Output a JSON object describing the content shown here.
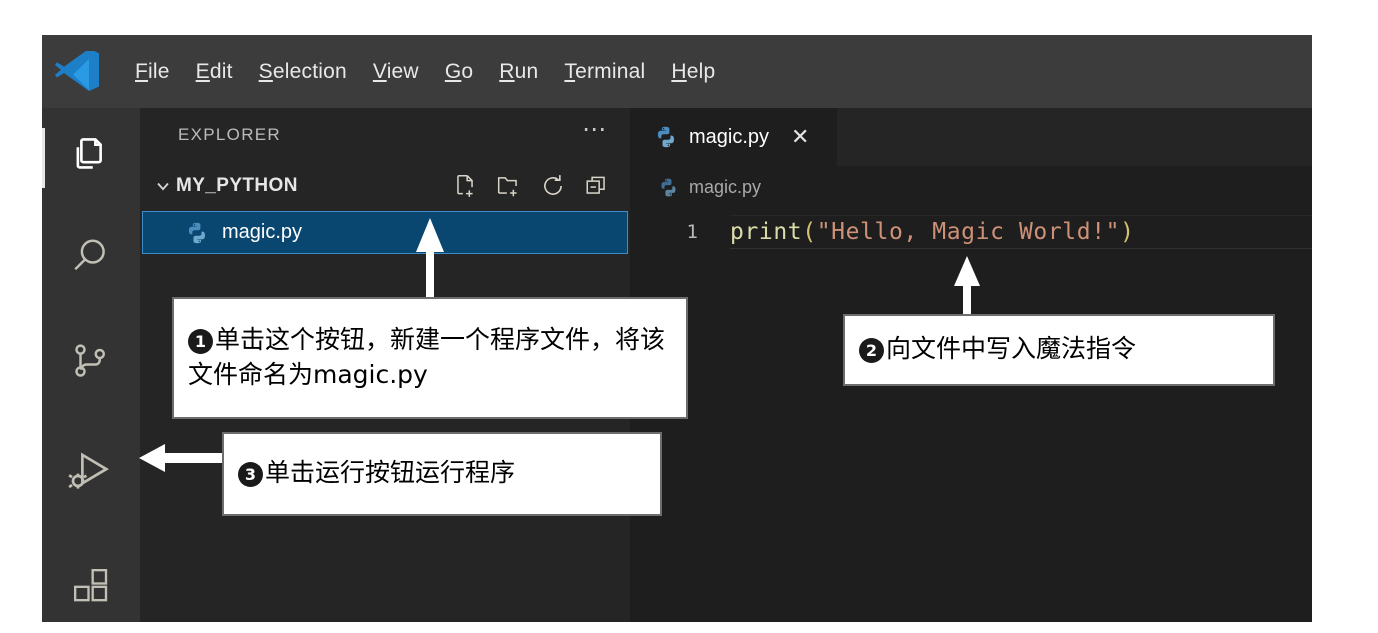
{
  "app": {
    "name": "Visual Studio Code",
    "logo_icon": "vscode-logo-icon"
  },
  "menubar": {
    "items": [
      {
        "mnemonic": "F",
        "rest": "ile",
        "label": "File"
      },
      {
        "mnemonic": "E",
        "rest": "dit",
        "label": "Edit"
      },
      {
        "mnemonic": "S",
        "rest": "election",
        "label": "Selection"
      },
      {
        "mnemonic": "V",
        "rest": "iew",
        "label": "View"
      },
      {
        "mnemonic": "G",
        "rest": "o",
        "label": "Go"
      },
      {
        "mnemonic": "R",
        "rest": "un",
        "label": "Run"
      },
      {
        "mnemonic": "T",
        "rest": "erminal",
        "label": "Terminal"
      },
      {
        "mnemonic": "H",
        "rest": "elp",
        "label": "Help"
      }
    ]
  },
  "activitybar": {
    "items": [
      {
        "icon": "files-explorer-icon",
        "label": "Explorer",
        "active": true
      },
      {
        "icon": "search-icon",
        "label": "Search",
        "active": false
      },
      {
        "icon": "source-control-branch-icon",
        "label": "Source Control",
        "active": false
      },
      {
        "icon": "run-and-debug-icon",
        "label": "Run and Debug",
        "active": false
      },
      {
        "icon": "extensions-blocks-icon",
        "label": "Extensions",
        "active": false
      }
    ]
  },
  "sidebar": {
    "title": "EXPLORER",
    "more_actions_icon": "ellipsis-icon",
    "folder": {
      "name": "MY_PYTHON",
      "chevron_icon": "chevron-down-icon",
      "expanded": true,
      "actions": [
        {
          "icon": "new-file-icon",
          "label": "New File"
        },
        {
          "icon": "new-folder-icon",
          "label": "New Folder"
        },
        {
          "icon": "refresh-icon",
          "label": "Refresh Explorer"
        },
        {
          "icon": "collapse-all-icon",
          "label": "Collapse Folders in Explorer"
        }
      ]
    },
    "files": [
      {
        "name": "magic.py",
        "icon": "python-file-icon",
        "selected": true
      }
    ]
  },
  "editor": {
    "tab": {
      "name": "magic.py",
      "icon": "python-file-icon",
      "close_icon": "close-icon",
      "active": true
    },
    "breadcrumb": {
      "icon": "python-file-icon",
      "text": "magic.py"
    },
    "code": {
      "line_number": "1",
      "tokens": [
        {
          "text": "print",
          "type": "function"
        },
        {
          "text": "(",
          "type": "paren"
        },
        {
          "text": "\"Hello, Magic World!\"",
          "type": "string"
        },
        {
          "text": ")",
          "type": "paren"
        }
      ],
      "full_line": "print(\"Hello, Magic World!\")"
    }
  },
  "callouts": [
    {
      "number": "1",
      "number_glyph": "❶",
      "text": "单击这个按钮，新建一个程序文件，将该文件命名为magic.py",
      "arrow": "arrow-up",
      "points_to": "new-file-icon"
    },
    {
      "number": "2",
      "number_glyph": "❷",
      "text": "向文件中写入魔法指令",
      "arrow": "arrow-up",
      "points_to": "code-line"
    },
    {
      "number": "3",
      "number_glyph": "❸",
      "text": "单击运行按钮运行程序",
      "arrow": "arrow-left",
      "points_to": "run-and-debug-icon"
    }
  ],
  "colors": {
    "menubar_bg": "#3c3c3c",
    "activitybar_bg": "#333333",
    "sidebar_bg": "#252526",
    "editor_bg": "#1e1e1e",
    "selection_blue": "#094771",
    "selection_border": "#3f8cc9",
    "accent_python_blue": "#4b8bbe",
    "string_orange": "#ce9178",
    "function_yellow": "#dcdcaa",
    "callout_bg": "#ffffff",
    "callout_border": "#6d6d6d",
    "page_bg": "#ffffff"
  }
}
